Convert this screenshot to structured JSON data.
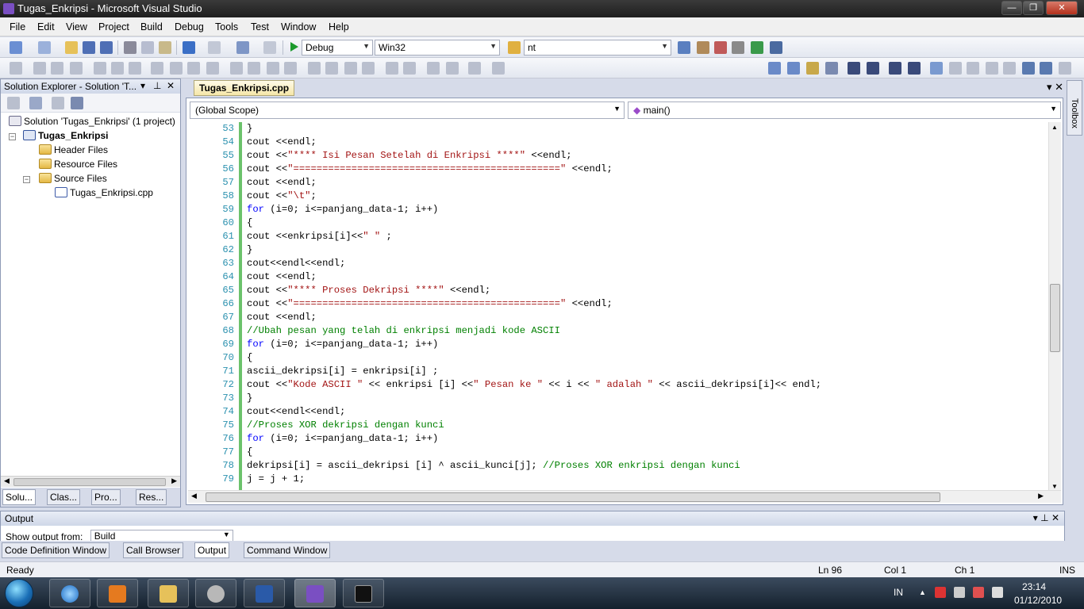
{
  "window": {
    "title": "Tugas_Enkripsi - Microsoft Visual Studio",
    "minimize": "—",
    "maximize": "❐",
    "close": "✕"
  },
  "menu": [
    "File",
    "Edit",
    "View",
    "Project",
    "Build",
    "Debug",
    "Tools",
    "Test",
    "Window",
    "Help"
  ],
  "toolbar": {
    "config": "Debug",
    "platform": "Win32",
    "find": "nt"
  },
  "solution_explorer": {
    "title": "Solution Explorer - Solution 'T...",
    "pin": "⊥",
    "close": "✕",
    "dropdown": "▾",
    "tree": {
      "solution": "Solution 'Tugas_Enkripsi' (1 project)",
      "project": "Tugas_Enkripsi",
      "header_files": "Header Files",
      "resource_files": "Resource Files",
      "source_files": "Source Files",
      "cpp_file": "Tugas_Enkripsi.cpp"
    },
    "tabs": [
      "Solu...",
      "Clas...",
      "Pro...",
      "Res..."
    ]
  },
  "editor": {
    "tab": "Tugas_Enkripsi.cpp",
    "scope": "(Global Scope)",
    "member": "main()",
    "tab_area_buttons": "▾  ✕",
    "lines": [
      {
        "no": "53",
        "code": "}"
      },
      {
        "no": "54",
        "code": "cout <<endl;"
      },
      {
        "no": "55",
        "code": "cout <<\"**** Isi Pesan Setelah di Enkripsi ****\" <<endl;"
      },
      {
        "no": "56",
        "code": "cout <<\"==============================================\" <<endl;"
      },
      {
        "no": "57",
        "code": "cout <<endl;"
      },
      {
        "no": "58",
        "code": "cout <<\"\\t\";"
      },
      {
        "no": "59",
        "code": "for (i=0; i<=panjang_data-1; i++)"
      },
      {
        "no": "60",
        "code": "{"
      },
      {
        "no": "61",
        "code": "cout <<enkripsi[i]<<\" \" ;"
      },
      {
        "no": "62",
        "code": "}"
      },
      {
        "no": "63",
        "code": "cout<<endl<<endl;"
      },
      {
        "no": "64",
        "code": "cout <<endl;"
      },
      {
        "no": "65",
        "code": "cout <<\"**** Proses Dekripsi ****\" <<endl;"
      },
      {
        "no": "66",
        "code": "cout <<\"==============================================\" <<endl;"
      },
      {
        "no": "67",
        "code": "cout <<endl;"
      },
      {
        "no": "68",
        "code": "//Ubah pesan yang telah di enkripsi menjadi kode ASCII"
      },
      {
        "no": "69",
        "code": "for (i=0; i<=panjang_data-1; i++)"
      },
      {
        "no": "70",
        "code": "{"
      },
      {
        "no": "71",
        "code": "ascii_dekripsi[i] = enkripsi[i] ;"
      },
      {
        "no": "72",
        "code": "cout <<\"Kode ASCII \" << enkripsi [i] <<\" Pesan ke \" << i << \" adalah \" << ascii_dekripsi[i]<< endl;"
      },
      {
        "no": "73",
        "code": "}"
      },
      {
        "no": "74",
        "code": "cout<<endl<<endl;"
      },
      {
        "no": "75",
        "code": "//Proses XOR dekripsi dengan kunci"
      },
      {
        "no": "76",
        "code": "for (i=0; i<=panjang_data-1; i++)"
      },
      {
        "no": "77",
        "code": "{"
      },
      {
        "no": "78",
        "code": "dekripsi[i] = ascii_dekripsi [i] ^ ascii_kunci[j]; //Proses XOR enkripsi dengan kunci"
      },
      {
        "no": "79",
        "code": "j = j + 1;"
      }
    ]
  },
  "toolbox": {
    "label": "Toolbox"
  },
  "output": {
    "title": "Output",
    "header_buttons": "▾ ⊥ ✕",
    "show_from_label": "Show output from:",
    "show_from_value": "Build"
  },
  "bottom_tabs": [
    "Code Definition Window",
    "Call Browser",
    "Output",
    "Command Window"
  ],
  "status": {
    "text": "Ready",
    "ln": "Ln 96",
    "col": "Col 1",
    "ch": "Ch 1",
    "mode": "INS"
  },
  "taskbar": {
    "lang": "IN",
    "time": "23:14",
    "date": "01/12/2010",
    "tray_arrow": "▲"
  },
  "colors": {
    "keyword": "#0000ff",
    "string": "#a31515",
    "comment": "#008000",
    "line_number": "#2b91af"
  }
}
